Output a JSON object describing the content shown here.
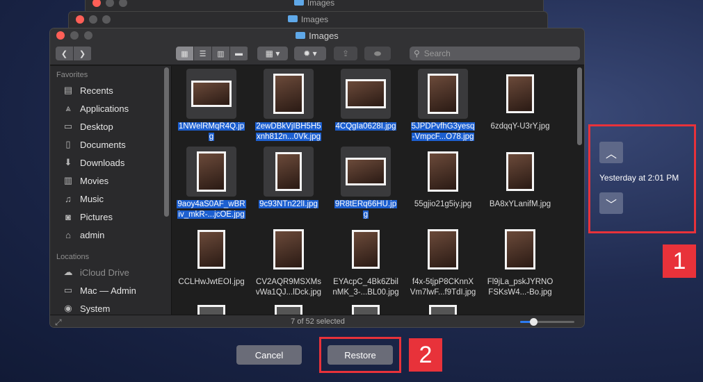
{
  "background_windows": [
    {
      "title": "Images"
    },
    {
      "title": "Images"
    }
  ],
  "window": {
    "title": "Images",
    "toolbar": {
      "back_icon": "chevron-left-icon",
      "forward_icon": "chevron-right-icon",
      "search_placeholder": "Search"
    },
    "sidebar": {
      "sections": [
        {
          "heading": "Favorites",
          "items": [
            {
              "label": "Recents",
              "icon": "clock-icon",
              "glyph": "▤"
            },
            {
              "label": "Applications",
              "icon": "applications-icon",
              "glyph": "⩓"
            },
            {
              "label": "Desktop",
              "icon": "desktop-icon",
              "glyph": "▭"
            },
            {
              "label": "Documents",
              "icon": "documents-icon",
              "glyph": "▯"
            },
            {
              "label": "Downloads",
              "icon": "download-icon",
              "glyph": "⬇"
            },
            {
              "label": "Movies",
              "icon": "film-icon",
              "glyph": "▥"
            },
            {
              "label": "Music",
              "icon": "music-icon",
              "glyph": "♫"
            },
            {
              "label": "Pictures",
              "icon": "camera-icon",
              "glyph": "◙"
            },
            {
              "label": "admin",
              "icon": "home-icon",
              "glyph": "⌂"
            }
          ]
        },
        {
          "heading": "Locations",
          "items": [
            {
              "label": "iCloud Drive",
              "icon": "cloud-icon",
              "glyph": "☁"
            },
            {
              "label": "Mac — Admin",
              "icon": "computer-icon",
              "glyph": "▭"
            },
            {
              "label": "System",
              "icon": "disk-icon",
              "glyph": "◉"
            }
          ]
        }
      ]
    },
    "files": [
      {
        "name_l1": "1NWelRMqR4Q.jp",
        "name_l2": "g",
        "selected": true
      },
      {
        "name_l1": "2ewDBkVjIBH5H5",
        "name_l2": "xnh812n...0Vk.jpg",
        "selected": true
      },
      {
        "name_l1": "4CQgIa0628I.jpg",
        "name_l2": "",
        "selected": true
      },
      {
        "name_l1": "5JPDPvfhG3yesq",
        "name_l2": "-VmpcF...O78.jpg",
        "selected": true
      },
      {
        "name_l1": "6zdqqY-U3rY.jpg",
        "name_l2": "",
        "selected": false
      },
      {
        "name_l1": "9aoy4aS0AF_wBR",
        "name_l2": "iv_mkR-...jcOE.jpg",
        "selected": true
      },
      {
        "name_l1": "9c93NTn22lI.jpg",
        "name_l2": "",
        "selected": true
      },
      {
        "name_l1": "9R8tERq66HU.jp",
        "name_l2": "g",
        "selected": true
      },
      {
        "name_l1": "55gjio21g5iy.jpg",
        "name_l2": "",
        "selected": false
      },
      {
        "name_l1": "BA8xYLanifM.jpg",
        "name_l2": "",
        "selected": false
      },
      {
        "name_l1": "CCLHwJwtEOI.jpg",
        "name_l2": "",
        "selected": false
      },
      {
        "name_l1": "CV2AQR9MSXMs",
        "name_l2": "vWa1QJ...lDck.jpg",
        "selected": false
      },
      {
        "name_l1": "EYAcpC_4Bk6Zbil",
        "name_l2": "nMK_3-...BL00.jpg",
        "selected": false
      },
      {
        "name_l1": "f4x-5tjpP8CKnnX",
        "name_l2": "Vm7lwF...f9TdI.jpg",
        "selected": false
      },
      {
        "name_l1": "Fl9jLa_pskJYRNO",
        "name_l2": "FSKsW4...-Bo.jpg",
        "selected": false
      }
    ],
    "status_text": "7 of 52 selected",
    "zoom_level": 0.24
  },
  "time_machine": {
    "date_label": "Yesterday at 2:01 PM",
    "up_icon": "chevron-up-icon",
    "down_icon": "chevron-down-icon",
    "callout_1": "1",
    "callout_2": "2"
  },
  "buttons": {
    "cancel_label": "Cancel",
    "restore_label": "Restore"
  },
  "colors": {
    "selection": "#1c5fd0",
    "highlight_box": "#e8323a",
    "button": "#6a6c78"
  }
}
